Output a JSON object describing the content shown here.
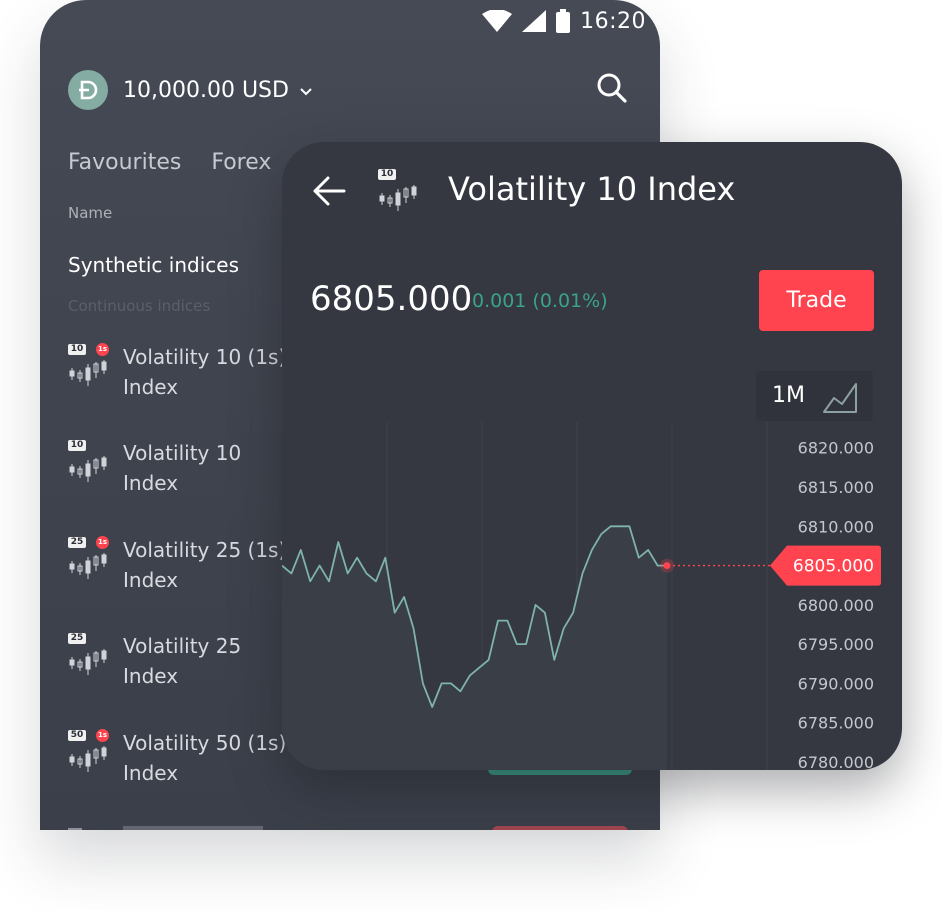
{
  "status_bar": {
    "time": "16:20"
  },
  "account": {
    "balance": "10,000.00 USD"
  },
  "tabs": [
    "Favourites",
    "Forex"
  ],
  "list": {
    "column_header": "Name",
    "section_title": "Synthetic indices",
    "section_subtitle": "Continuous indices",
    "markets": [
      {
        "badge": "10",
        "one_second": true,
        "line1": "Volatility 10 (1s)",
        "line2": "Index"
      },
      {
        "badge": "10",
        "one_second": false,
        "line1": "Volatility 10",
        "line2": "Index"
      },
      {
        "badge": "25",
        "one_second": true,
        "line1": "Volatility 25 (1s)",
        "line2": "Index"
      },
      {
        "badge": "25",
        "one_second": false,
        "line1": "Volatility 25",
        "line2": "Index"
      },
      {
        "badge": "50",
        "one_second": true,
        "line1": "Volatility 50 (1s)",
        "line2": "Index"
      }
    ],
    "one_second_badge": "1s"
  },
  "detail": {
    "badge": "10",
    "title": "Volatility 10 Index",
    "price": "6805.000",
    "change": "0.001 (0.01%)",
    "trade_label": "Trade",
    "period": "1M",
    "current_price_tag": "6805.000"
  },
  "colors": {
    "accent_red": "#ff444f",
    "accent_green": "#3aa28a",
    "chart_line": "#7fb3ad",
    "card_bg": "#353841",
    "phone_bg": "#43474f"
  },
  "chart_data": {
    "type": "line",
    "y_ticks": [
      "6820.000",
      "6815.000",
      "6810.000",
      "6805.000",
      "6800.000",
      "6795.000",
      "6790.000",
      "6785.000",
      "6780.000"
    ],
    "ylim": [
      6780,
      6822
    ],
    "current_value": 6805,
    "values": [
      6805,
      6804,
      6807,
      6803,
      6805,
      6803,
      6808,
      6804,
      6806,
      6804,
      6803,
      6806,
      6799,
      6801,
      6797,
      6790,
      6787,
      6790,
      6790,
      6789,
      6791,
      6792,
      6793,
      6798,
      6798,
      6795,
      6795,
      6800,
      6799,
      6793,
      6797,
      6799,
      6804,
      6807,
      6809,
      6810,
      6810,
      6810,
      6806,
      6807,
      6805,
      6805
    ]
  }
}
